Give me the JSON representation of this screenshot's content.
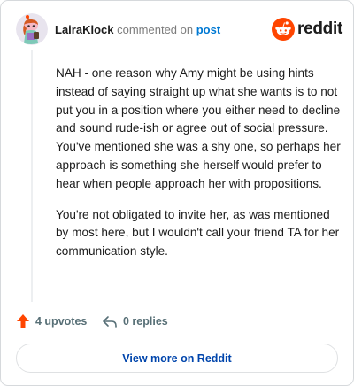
{
  "header": {
    "username": "LairaKlock",
    "verb": "commented on",
    "post_link": "post",
    "logo_text": "reddit"
  },
  "comment": {
    "paragraphs": [
      "NAH - one reason why Amy might be using hints instead of saying straight up what she wants is to not put you in a position where you either need to decline and sound rude-ish or agree out of social pressure. You've mentioned she was a shy one, so perhaps her approach is something she herself would prefer to hear when people approach her with propositions.",
      "You're not obligated to invite her, as was mentioned by most here, but I wouldn't call your friend TA for her communication style."
    ]
  },
  "actions": {
    "upvotes": "4 upvotes",
    "replies": "0 replies"
  },
  "footer": {
    "view_more": "View more on Reddit"
  },
  "colors": {
    "upvote_accent": "#ff4500",
    "link": "#0079d3",
    "button_text": "#0045ac",
    "muted": "#576f76"
  },
  "icons": {
    "avatar": "avatar-snoo",
    "logo": "reddit-logo-icon",
    "upvote": "upvote-arrow-icon",
    "reply": "reply-arrow-icon"
  }
}
